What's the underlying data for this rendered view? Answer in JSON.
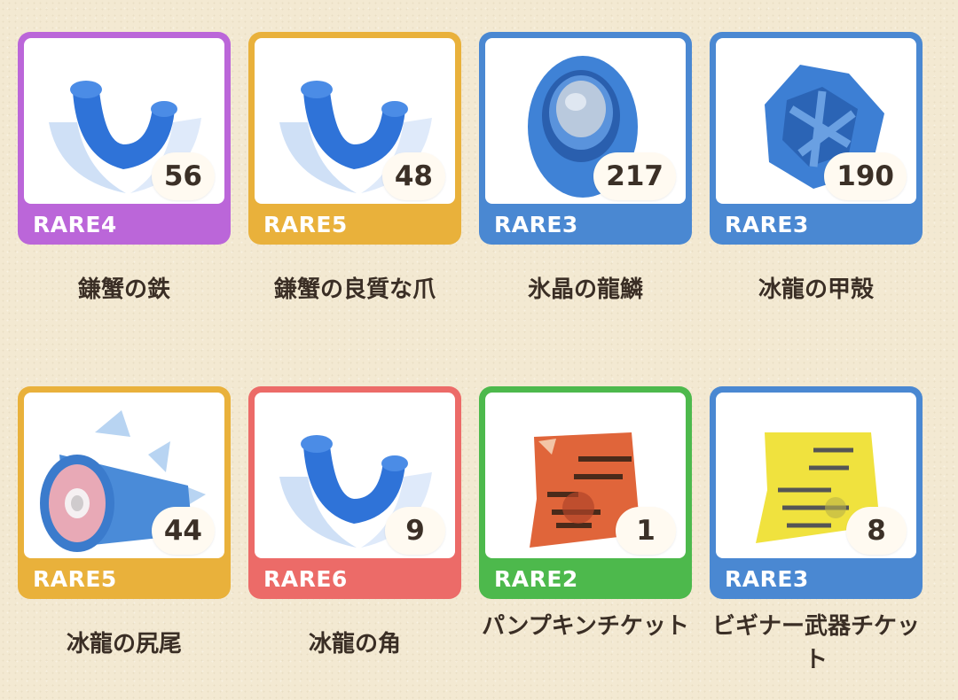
{
  "items": [
    {
      "rarity": "RARE4",
      "count": "56",
      "name": "鎌蟹の鉄",
      "color": "#bb66d9",
      "icon": "claw-icon"
    },
    {
      "rarity": "RARE5",
      "count": "48",
      "name": "鎌蟹の良質な爪",
      "color": "#e9b13b",
      "icon": "claw-icon"
    },
    {
      "rarity": "RARE3",
      "count": "217",
      "name": "氷晶の龍鱗",
      "color": "#4a88d2",
      "icon": "scale-icon"
    },
    {
      "rarity": "RARE3",
      "count": "190",
      "name": "冰龍の甲殻",
      "color": "#4a88d2",
      "icon": "shell-icon"
    },
    {
      "rarity": "RARE5",
      "count": "44",
      "name": "冰龍の尻尾",
      "color": "#e9b13b",
      "icon": "tail-icon"
    },
    {
      "rarity": "RARE6",
      "count": "9",
      "name": "冰龍の角",
      "color": "#ec6b68",
      "icon": "claw-icon"
    },
    {
      "rarity": "RARE2",
      "count": "1",
      "name": "パンプキンチケット",
      "color": "#4db94c",
      "icon": "ticket-icon"
    },
    {
      "rarity": "RARE3",
      "count": "8",
      "name": "ビギナー武器チケット",
      "color": "#4a88d2",
      "icon": "ticket-icon"
    }
  ]
}
